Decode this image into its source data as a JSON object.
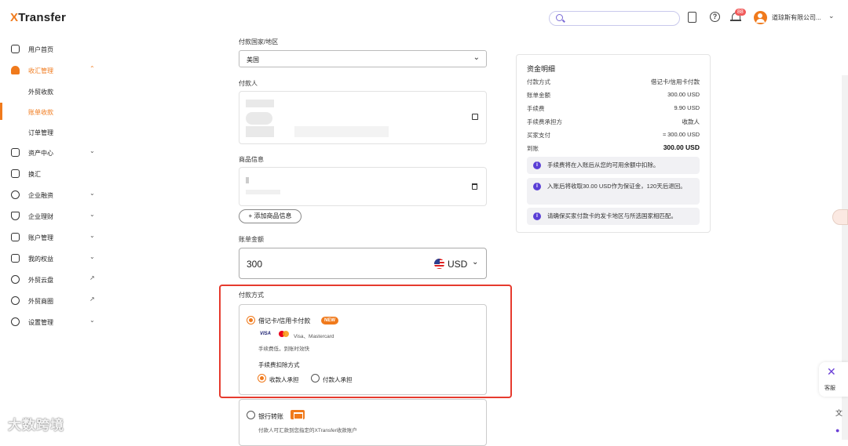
{
  "header": {
    "logo_x": "X",
    "logo_rest": "Transfer",
    "search_placeholder": "",
    "notification_count": "88",
    "company_name": "道琼斯有限公司..."
  },
  "sidebar": {
    "items": [
      {
        "label": "用户首页",
        "icon": "home-icon"
      },
      {
        "label": "收汇管理",
        "icon": "user-icon",
        "active": true
      },
      {
        "label": "资产中心",
        "icon": "wallet-icon"
      },
      {
        "label": "换汇",
        "icon": "exchange-icon"
      },
      {
        "label": "企业融资",
        "icon": "dollar-icon"
      },
      {
        "label": "企业理财",
        "icon": "shield-icon"
      },
      {
        "label": "账户管理",
        "icon": "account-icon"
      },
      {
        "label": "我的权益",
        "icon": "gift-icon"
      },
      {
        "label": "外贸云盘",
        "icon": "cloud-icon"
      },
      {
        "label": "外贸商圈",
        "icon": "eye-icon"
      },
      {
        "label": "设置管理",
        "icon": "gear-icon"
      }
    ],
    "sub_items": [
      "外贸收款",
      "账单收款",
      "订单管理"
    ]
  },
  "form": {
    "country_label": "付款国家/地区",
    "country_value": "美国",
    "payer_label": "付款人",
    "goods_label": "商品信息",
    "add_goods": "+ 添加商品信息",
    "amount_label": "账单金额",
    "amount_value": "300",
    "currency": "USD",
    "payment_method_label": "付款方式",
    "card_option": "借记卡/信用卡付款",
    "new_tag": "NEW",
    "visa_text": "VISA",
    "card_brands": "Visa、Mastercard",
    "card_desc": "手续费低，到账时效快",
    "fee_method_label": "手续费扣除方式",
    "fee_receiver": "收款人承担",
    "fee_payer": "付款人承担",
    "bank_option": "银行转账",
    "bank_desc": "付款人可汇款到您指定的XTransfer收款账户"
  },
  "summary": {
    "title": "资金明细",
    "rows": [
      {
        "label": "付款方式",
        "value": "借记卡/信用卡付款"
      },
      {
        "label": "账单金额",
        "value": "300.00 USD"
      },
      {
        "label": "手续费",
        "value": "9.90 USD"
      },
      {
        "label": "手续费承担方",
        "value": "收款人"
      },
      {
        "label": "买家支付",
        "value": "≈ 300.00 USD"
      },
      {
        "label": "到账",
        "value": "300.00 USD"
      }
    ],
    "notes": [
      "手续费将在入账后从您的可用余额中扣除。",
      "入账后将收取30.00 USD作为保证金，120天后退回。",
      "请确保买家付款卡的发卡地区与所选国家相匹配。"
    ]
  },
  "floating": {
    "service_label": "客服",
    "watermark": "大数跨境"
  }
}
